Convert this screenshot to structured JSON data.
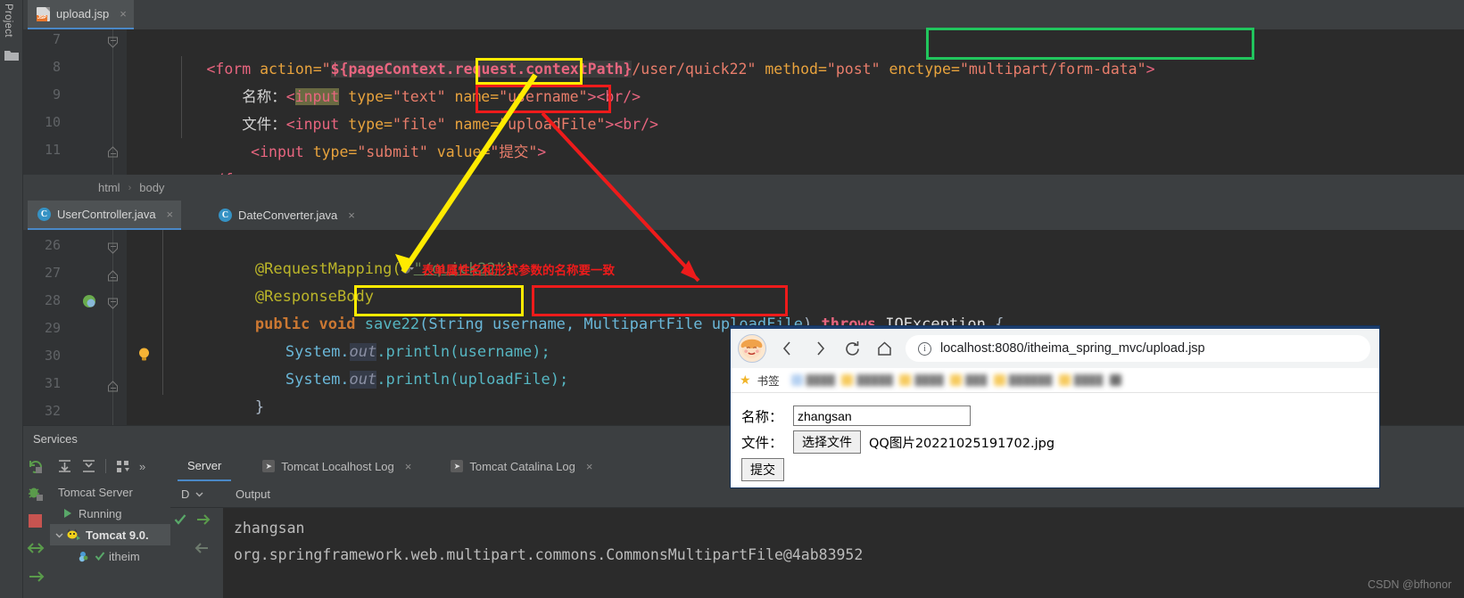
{
  "ide": {
    "left_strip": {
      "project_label": "Project",
      "folder_icon": "folder-icon"
    },
    "jsp_tab": {
      "label": "upload.jsp",
      "close": "×",
      "icon": "jsp-file-icon"
    },
    "jsp_lines": [
      {
        "num": "7"
      },
      {
        "num": "8"
      },
      {
        "num": "9"
      },
      {
        "num": "10"
      },
      {
        "num": "11"
      }
    ],
    "jsp_code": {
      "l7_a": "<form",
      "l7_b": "action=",
      "l7_q1": "\"",
      "l7_el": "${pageContext.request.contextPath}",
      "l7_path": "/user/quick22\"",
      "l7_method": "method=",
      "l7_methodval": "\"post\"",
      "l7_enctype": "enctype=",
      "l7_enctypeval": "\"multipart/form-data\"",
      "l7_close": ">",
      "l8_cn": "名称：",
      "l8_lt": "<",
      "l8_input": "input",
      "l8_type": "type=",
      "l8_typeval": "\"text\"",
      "l8_name": "name=",
      "l8_nameval": "\"username\"",
      "l8_gt": ">",
      "l8_br": "<br/>",
      "l9_cn": "文件：",
      "l9_lt": "<input",
      "l9_type": "type=",
      "l9_typeval": "\"file\"",
      "l9_name": "name=",
      "l9_nameval": "\"uploadFile\"",
      "l9_gt": ">",
      "l9_br": "<br/>",
      "l10_lt": "<input",
      "l10_type": "type=",
      "l10_typeval": "\"submit\"",
      "l10_value": "value=",
      "l10_valueval": "\"提交\"",
      "l10_gt": ">",
      "l11": "</form>"
    },
    "breadcrumb": {
      "first": "html",
      "sep": "›",
      "second": "body"
    },
    "java_tabs": [
      {
        "label": "UserController.java",
        "icon": "class-icon",
        "letter": "C",
        "close": "×",
        "active": true
      },
      {
        "label": "DateConverter.java",
        "icon": "class-icon",
        "letter": "C",
        "close": "×",
        "active": false
      }
    ],
    "java_lines": [
      {
        "num": "26"
      },
      {
        "num": "27"
      },
      {
        "num": "28"
      },
      {
        "num": "29"
      },
      {
        "num": "30"
      },
      {
        "num": "31"
      },
      {
        "num": "32"
      }
    ],
    "java_code": {
      "l26_anno": "@RequestMapping(",
      "l26_str": "\"/quick22\"",
      "l26_close": ")",
      "l27": "@ResponseBody",
      "l28_kw": "public void",
      "l28_m": "save22",
      "l28_p1": "(String username,",
      "l28_p2": "MultipartFile uploadFile",
      "l28_p3": ")",
      "l28_kw2": "throws",
      "l28_exc": "IOException",
      "l28_brace": "{",
      "l29_sys": "System.",
      "l29_out": "out",
      "l29_rest": ".println(username);",
      "l30_sys": "System.",
      "l30_out": "out",
      "l30_rest": ".println(uploadFile);",
      "l31": "}"
    },
    "annotation": {
      "text": "表单属性名和形式参数的名称要一致",
      "color_green": "#21c55d",
      "color_yellow": "#ffeb00",
      "color_red": "#ee1b1b"
    },
    "services": {
      "title": "Services",
      "toolbar_icons": [
        "rerun-icon",
        "expand-all-icon",
        "collapse-all-icon",
        "group-icon",
        "more-icon"
      ],
      "side_icons": [
        "rerun-icon",
        "debug-icon",
        "stop-icon",
        "deploy-icon"
      ],
      "tree": [
        {
          "label": "Tomcat Server",
          "icon": ""
        },
        {
          "label": "Running",
          "icon": "run-triangle-icon"
        },
        {
          "label": "Tomcat 9.0.",
          "icon": "tomcat-icon",
          "selected": true
        },
        {
          "label": "itheim",
          "icon": "artifact-icon"
        }
      ],
      "run_tabs": [
        {
          "label": "Server",
          "active": true,
          "icon": ""
        },
        {
          "label": "Tomcat Localhost Log",
          "active": false,
          "icon": "log-icon",
          "close": "×"
        },
        {
          "label": "Tomcat Catalina Log",
          "active": false,
          "icon": "log-icon",
          "close": "×"
        }
      ],
      "output_header": "Output",
      "d_label": "D",
      "console_lines": [
        "zhangsan",
        "org.springframework.web.multipart.commons.CommonsMultipartFile@4ab83952"
      ]
    },
    "watermark": "CSDN @bfhonor"
  },
  "browser": {
    "nav": {
      "avatar": "user-avatar",
      "back": "‹",
      "forward": "›",
      "reload": "reload-icon",
      "home": "home-icon",
      "info_icon": "info-icon",
      "url": "localhost:8080/itheima_spring_mvc/upload.jsp"
    },
    "bookmarks": {
      "star": "★",
      "label": "书签",
      "items": [
        "",
        "",
        "",
        "",
        "",
        "",
        ""
      ]
    },
    "form": {
      "name_label": "名称：",
      "name_value": "zhangsan",
      "file_label": "文件：",
      "choose_button": "选择文件",
      "file_name": "QQ图片20221025191702.jpg",
      "submit_button": "提交"
    }
  }
}
